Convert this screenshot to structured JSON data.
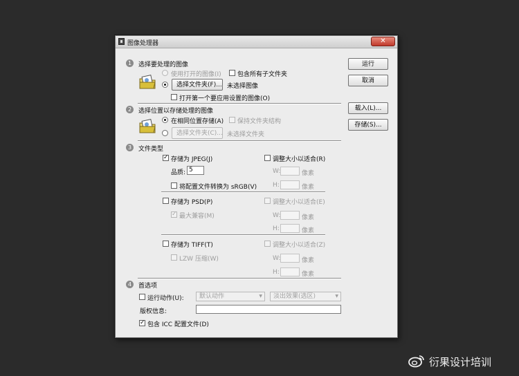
{
  "window": {
    "title": "图像处理器",
    "close_glyph": "✕"
  },
  "buttons": {
    "run": "运行",
    "cancel": "取消",
    "load": "载入(L)...",
    "save": "存储(S)..."
  },
  "section1": {
    "number": "1",
    "title": "选择要处理的图像",
    "use_open_images": "使用打开的图像(I)",
    "include_subfolders": "包含所有子文件夹",
    "select_folder_button": "选择文件夹(F)...",
    "no_images_selected": "未选择图像",
    "open_first_image": "打开第一个要应用设置的图像(O)"
  },
  "section2": {
    "number": "2",
    "title": "选择位置以存储处理的图像",
    "same_location": "在相同位置存储(A)",
    "keep_structure": "保持文件夹结构",
    "select_folder_button": "选择文件夹(C)...",
    "no_folder_selected": "未选择文件夹"
  },
  "section3": {
    "number": "3",
    "title": "文件类型",
    "jpeg": {
      "save_as": "存储为 JPEG(J)",
      "quality_label": "品质:",
      "quality_value": "5",
      "convert_srgb": "将配置文件转换为 sRGB(V)",
      "resize": "调整大小以适合(R)",
      "w_label": "W:",
      "h_label": "H:",
      "px_unit": "像素"
    },
    "psd": {
      "save_as": "存储为 PSD(P)",
      "max_compat": "最大兼容(M)",
      "resize": "调整大小以适合(E)",
      "w_label": "W:",
      "h_label": "H:",
      "px_unit": "像素"
    },
    "tiff": {
      "save_as": "存储为 TIFF(T)",
      "lzw": "LZW 压缩(W)",
      "resize": "调整大小以适合(Z)",
      "w_label": "W:",
      "h_label": "H:",
      "px_unit": "像素"
    }
  },
  "section4": {
    "number": "4",
    "title": "首选项",
    "run_action": "运行动作(U):",
    "action_set": "默认动作",
    "action": "淡出效果(选区)",
    "copyright": "版权信息:",
    "copyright_value": "",
    "include_icc": "包含 ICC 配置文件(D)"
  },
  "checkmark": "✓",
  "dropdown_arrow": "▼",
  "watermark": {
    "text": "衍果设计培训"
  },
  "colors": {
    "close": "#c0392b",
    "background": "#2b2b2b",
    "dialog": "#ececec"
  },
  "icons": {
    "window": "photoshop-window-icon",
    "folder": "folder-with-image-icon",
    "watermark": "weibo-logo-icon"
  }
}
